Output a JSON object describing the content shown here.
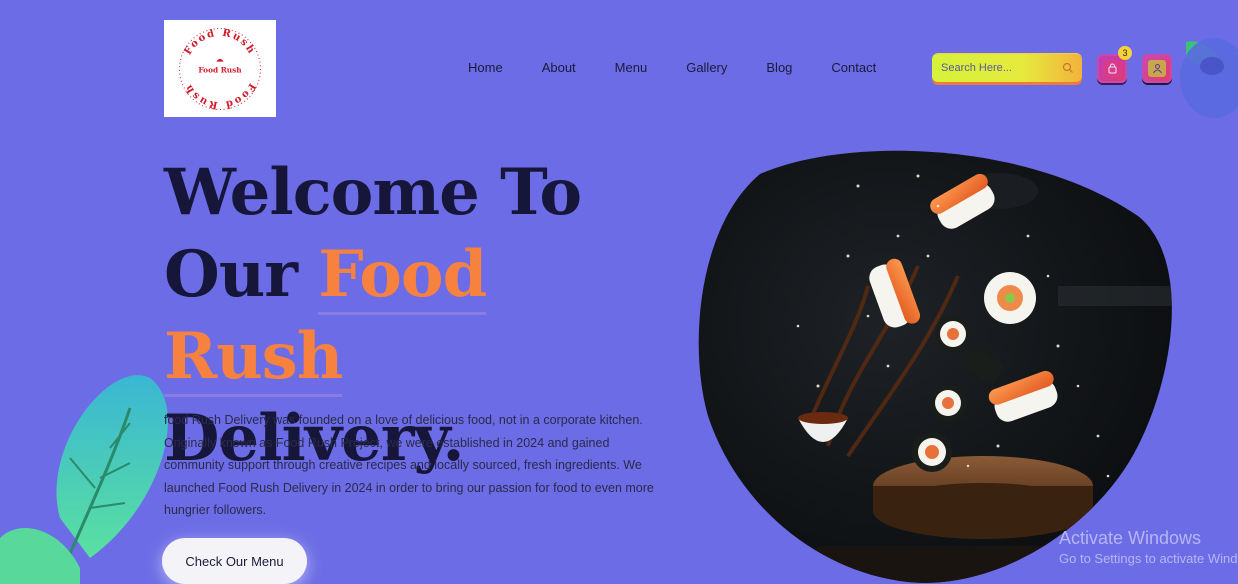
{
  "logo": {
    "ring_text": "Food Rush",
    "center_text": "Food Rush",
    "color": "#d31a2a"
  },
  "nav": {
    "items": [
      "Home",
      "About",
      "Menu",
      "Gallery",
      "Blog",
      "Contact"
    ]
  },
  "search": {
    "placeholder": "Search Here...",
    "icon": "search-icon"
  },
  "cart": {
    "icon": "cart-icon",
    "count": "3"
  },
  "user": {
    "icon": "user-icon"
  },
  "hero": {
    "line1": "Welcome To",
    "line2_prefix": "Our",
    "line2_accent": "Food Rush",
    "line3": "Delivery.",
    "description": "food Rush Delivery was founded on a love of delicious food, not in a corporate kitchen. Originally known as Food Rush Project, we were established in 2024 and gained community support through creative recipes and locally sourced, fresh ingredients. We launched Food Rush Delivery in 2024 in order to bring our passion for food to even more hungrier followers.",
    "cta_label": "Check Our Menu",
    "image": "flying-sushi-image"
  },
  "watermark": {
    "title": "Activate Windows",
    "subtitle": "Go to Settings to activate Windows."
  },
  "colors": {
    "background": "#6c6ce6",
    "accent": "#f7813f",
    "heading": "#16163a"
  }
}
